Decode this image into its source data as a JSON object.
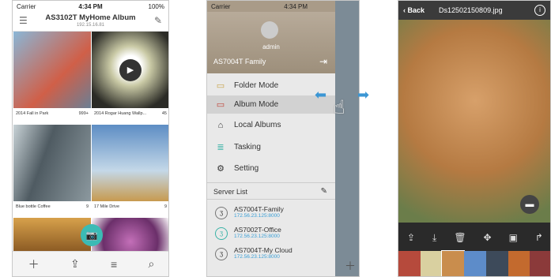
{
  "p1": {
    "status": {
      "carrier": "Carrier",
      "time": "4:34 PM",
      "battery": "100%"
    },
    "title": "AS3102T MyHome Album",
    "ip": "192.15.16.81",
    "albums": [
      {
        "name": "2014 Fall in Park",
        "count": "999+"
      },
      {
        "name": "2014 Rogar Huang Wallp...",
        "count": "45"
      },
      {
        "name": "Blue bottle Coffee",
        "count": "9"
      },
      {
        "name": "17 Mile Drive",
        "count": "9"
      }
    ]
  },
  "p2": {
    "status": {
      "carrier": "Carrier",
      "time": "4:34 PM"
    },
    "user": "admin",
    "current_server": "AS7004T Family",
    "menu": [
      "Folder Mode",
      "Album Mode",
      "Local Albums",
      "Tasking",
      "Setting"
    ],
    "server_list_label": "Server List",
    "servers": [
      {
        "name": "AS7004T-Family",
        "ip": "172.56.23.125:8000"
      },
      {
        "name": "AS7002T-Office",
        "ip": "172.56.23.125:8000"
      },
      {
        "name": "AS7004T-My Cloud",
        "ip": "172.56.23.125:8000"
      }
    ]
  },
  "p3": {
    "back": "Back",
    "filename": "Ds12502150809.jpg"
  }
}
